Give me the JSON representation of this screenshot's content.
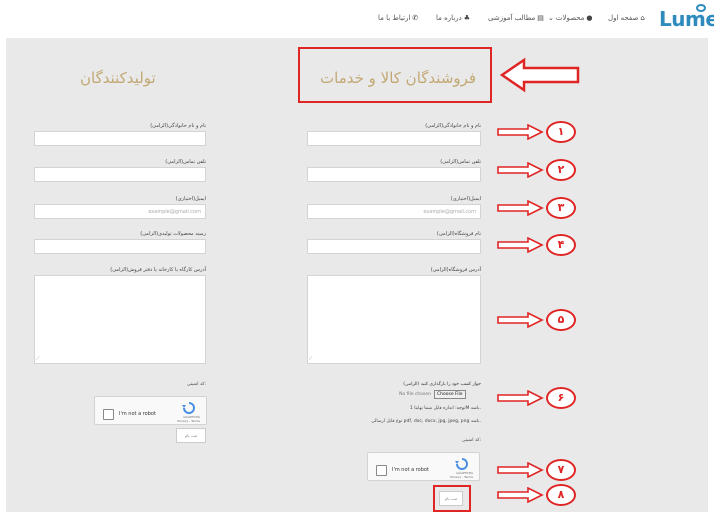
{
  "nav": {
    "logo": "Lumen",
    "home": "صفحه اول",
    "products": "محصولات",
    "articles": "مطالب آموزشی",
    "about": "درباره ما",
    "contact": "ارتباط با ما"
  },
  "sellers": {
    "title": "فروشندگان کالا و خدمات",
    "name_label": "نام و نام خانوادگی(الزامی)",
    "phone_label": "تلفن تماس(الزامی)",
    "email_label": "ایمیل(اختیاری)",
    "email_placeholder": "example@gmail.com",
    "store_label": "نام فروشگاه(الزامی)",
    "address_label": "آدرس فروشگاه(الزامی)",
    "license_label": "جواز کسب خود را بارگذاری کنید (الزامی)",
    "choose_file": "Choose File",
    "no_file": "No file chosen",
    "size_note": "توجه: اندازه فایل شما نهایتا 1M باشد.",
    "type_note": "نوع فایل ارسالی pdf, doc, docx, jpg, jpeg, png باشد.",
    "security_label": "کد امنیتی:",
    "submit": "ثبت نام"
  },
  "producers": {
    "title": "تولیدکنندگان",
    "name_label": "نام و نام خانوادگی(الزامی)",
    "phone_label": "تلفن تماس(الزامی)",
    "email_label": "ایمیل(اختیاری)",
    "email_placeholder": "example@gmail.com",
    "products_label": "زمینه محصولات تولیدی(الزامی)",
    "address_label": "آدرس کارگاه یا کارخانه یا دفتر فروش(الزامی)",
    "security_label": "کد امنیتی:",
    "submit": "ثبت نام"
  },
  "captcha": {
    "text": "I'm not a robot",
    "brand": "reCAPTCHA",
    "links": "Privacy - Terms"
  },
  "annotations": [
    "۱",
    "۲",
    "۳",
    "۴",
    "۵",
    "۶",
    "۷",
    "۸"
  ],
  "colors": {
    "annotation": "#e02525",
    "title": "#c2a874",
    "background": "#e9e9e9",
    "logo": "#2f8bbd"
  }
}
